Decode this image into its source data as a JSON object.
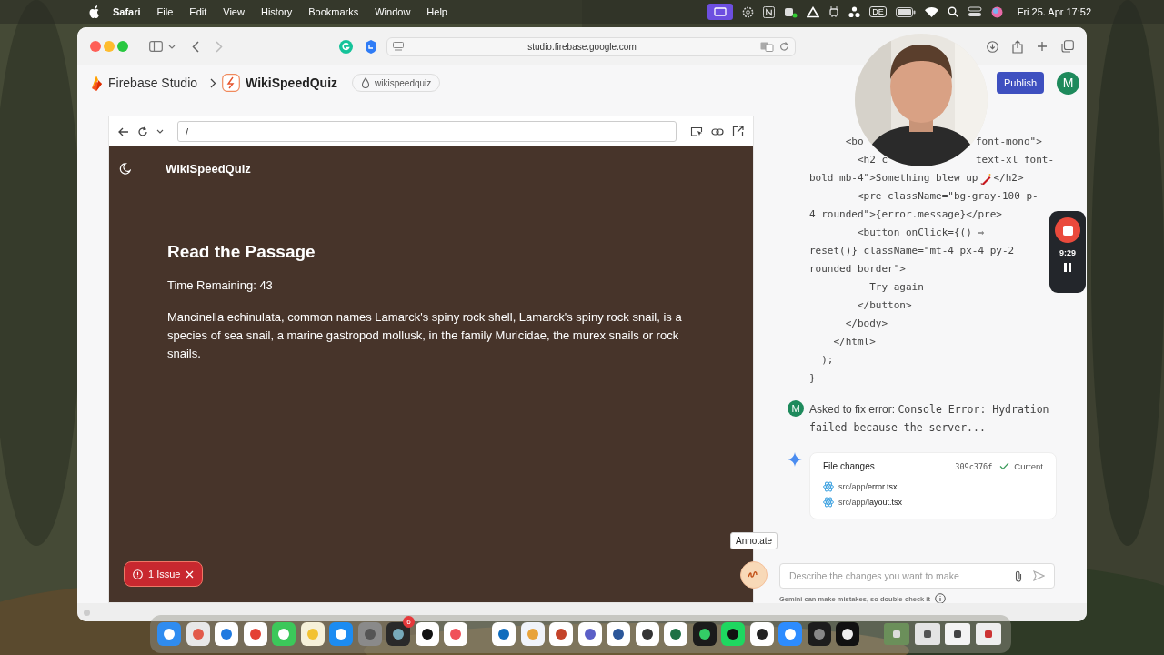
{
  "menubar": {
    "app": "Safari",
    "menus": [
      "File",
      "Edit",
      "View",
      "History",
      "Bookmarks",
      "Window",
      "Help"
    ],
    "language": "DE",
    "clock": "Fri 25. Apr  17:52"
  },
  "browser": {
    "url": "studio.firebase.google.com"
  },
  "header": {
    "product": "Firebase Studio",
    "project": "WikiSpeedQuiz",
    "workspace": "wikispeedquiz",
    "publish": "Publish",
    "avatar": "M"
  },
  "preview": {
    "path": "/",
    "app_title": "WikiSpeedQuiz",
    "heading": "Read the Passage",
    "timer": "Time Remaining: 43",
    "passage": "Mancinella echinulata, common names Lamarck's spiny rock shell, Lamarck's spiny rock snail, is a species of sea snail, a marine gastropod mollusk, in the family Muricidae, the murex snails or rock snails.",
    "issues": "1 Issue"
  },
  "code_lines": [
    {
      "text": "      <bo",
      "right": "font-mono\">"
    },
    {
      "text": "        <h2 c",
      "right": "text-xl font-"
    },
    {
      "text": "bold mb-4\">Something blew up",
      "firecracker": true,
      "after": "</h2>"
    },
    {
      "text": "        <pre className=\"bg-gray-100 p-"
    },
    {
      "text": "4 rounded\">{error.message}</pre>"
    },
    {
      "text": "        <button onClick={() ⇒"
    },
    {
      "text": "reset()} className=\"mt-4 px-4 py-2"
    },
    {
      "text": "rounded border\">"
    },
    {
      "text": "          Try again"
    },
    {
      "text": "        </button>"
    },
    {
      "text": "      </body>"
    },
    {
      "text": "    </html>"
    },
    {
      "text": "  );"
    },
    {
      "text": "}"
    }
  ],
  "recording": {
    "time": "9:29"
  },
  "chat": {
    "user_avatar": "M",
    "message_prefix": "Asked to fix error:",
    "message": "Console Error: Hydration failed because the server...",
    "file_changes": {
      "title": "File changes",
      "commit": "309c376f",
      "status": "Current",
      "files": [
        {
          "dir": "src/app/",
          "name": "error.tsx"
        },
        {
          "dir": "src/app/",
          "name": "layout.tsx"
        }
      ]
    },
    "tooltip": "Annotate",
    "input_placeholder": "Describe the changes you want to make",
    "disclaimer": "Gemini can make mistakes, so double-check it"
  },
  "dock": {
    "badge": "6"
  }
}
